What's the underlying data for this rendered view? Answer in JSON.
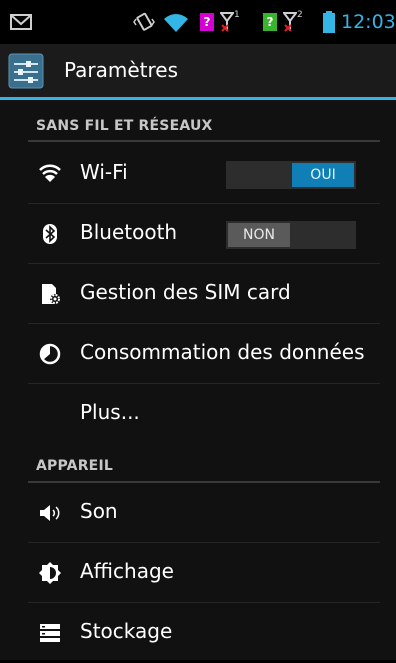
{
  "status_bar": {
    "time": "12:03",
    "sim1_badge": "?",
    "sim2_badge": "?",
    "sim1_number": "1",
    "sim2_number": "2",
    "icons": [
      "gmail-icon",
      "vibrate-icon",
      "wifi-signal-icon",
      "sim1-warning-icon",
      "signal-no-service-icon",
      "sim2-warning-icon",
      "battery-icon"
    ]
  },
  "action_bar": {
    "title": "Paramètres",
    "icon": "settings-app-icon"
  },
  "sections": [
    {
      "label": "SANS FIL ET RÉSEAUX",
      "items": [
        {
          "label": "Wi-Fi",
          "icon": "wifi-icon",
          "toggle": "OUI",
          "toggle_on": true
        },
        {
          "label": "Bluetooth",
          "icon": "bluetooth-icon",
          "toggle": "NON",
          "toggle_on": false
        },
        {
          "label": "Gestion des SIM card",
          "icon": "sim-settings-icon"
        },
        {
          "label": "Consommation des données",
          "icon": "data-usage-icon"
        },
        {
          "label": "Plus...",
          "icon": ""
        }
      ]
    },
    {
      "label": "APPAREIL",
      "items": [
        {
          "label": "Son",
          "icon": "speaker-icon"
        },
        {
          "label": "Affichage",
          "icon": "display-brightness-icon"
        },
        {
          "label": "Stockage",
          "icon": "storage-icon"
        }
      ]
    }
  ],
  "colors": {
    "accent": "#33b5e5",
    "sim_badge_magenta": "#d400d4",
    "sim_badge_green": "#39b52d",
    "error_red": "#e02020"
  }
}
